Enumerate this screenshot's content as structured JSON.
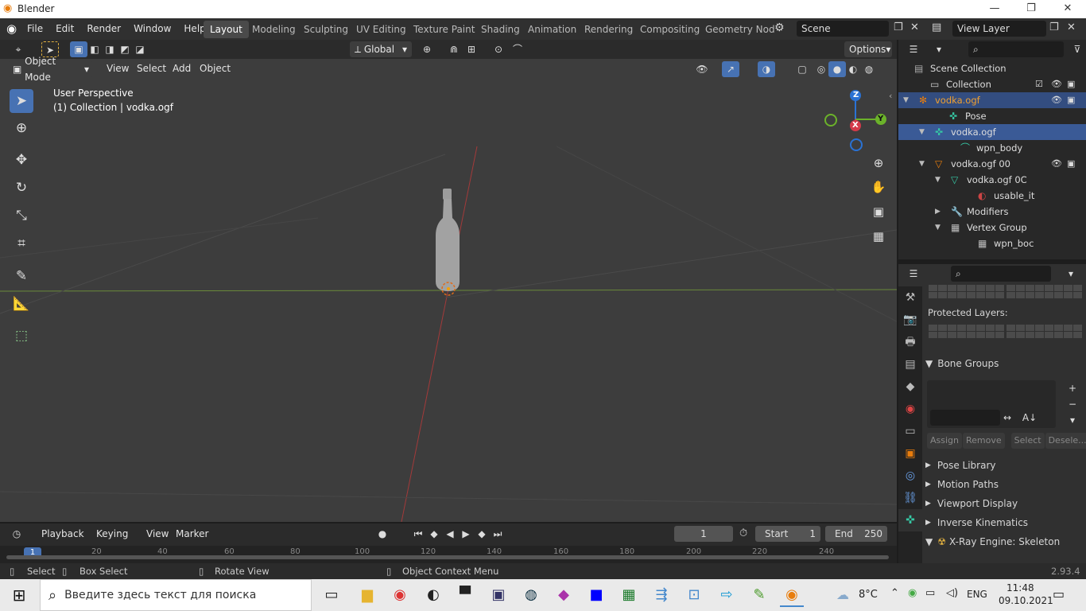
{
  "window": {
    "title": "Blender",
    "minimize": "—",
    "maximize": "❐",
    "close": "✕"
  },
  "menu": [
    "File",
    "Edit",
    "Render",
    "Window",
    "Help"
  ],
  "workspaces": [
    "Layout",
    "Modeling",
    "Sculpting",
    "UV Editing",
    "Texture Paint",
    "Shading",
    "Animation",
    "Rendering",
    "Compositing",
    "Geometry Nod"
  ],
  "scene": "Scene",
  "view_layer": "View Layer",
  "header": {
    "orientation": "Global",
    "options": "Options",
    "mode": "Object Mode",
    "menus": [
      "View",
      "Select",
      "Add",
      "Object"
    ]
  },
  "viewport": {
    "title": "User Perspective",
    "subtitle": "(1) Collection | vodka.ogf",
    "axis_x": "X",
    "axis_y": "Y",
    "axis_z": "Z"
  },
  "outliner": {
    "rows": [
      {
        "label": "Scene Collection",
        "icon": "scene-collection-icon",
        "glyph": "▤"
      },
      {
        "label": "Collection",
        "icon": "collection-icon",
        "glyph": "▭"
      },
      {
        "label": "vodka.ogf",
        "icon": "armature-icon",
        "glyph": "✻",
        "expand": "▼"
      },
      {
        "label": "Pose",
        "icon": "pose-icon",
        "glyph": "✜"
      },
      {
        "label": "vodka.ogf",
        "icon": "armature-data-icon",
        "glyph": "✜",
        "expand": "▼"
      },
      {
        "label": "wpn_body",
        "icon": "bone-icon",
        "glyph": "⌒"
      },
      {
        "label": "vodka.ogf 00",
        "icon": "mesh-object-icon",
        "glyph": "▽",
        "expand": "▼"
      },
      {
        "label": "vodka.ogf 0C",
        "icon": "mesh-data-icon",
        "glyph": "▽",
        "expand": "▼"
      },
      {
        "label": "usable_it",
        "icon": "material-icon",
        "glyph": "◐"
      },
      {
        "label": "Modifiers",
        "icon": "wrench-icon",
        "glyph": "🔧",
        "expand": "▶"
      },
      {
        "label": "Vertex Group",
        "icon": "vertex-group-icon",
        "glyph": "▦",
        "expand": "▼"
      },
      {
        "label": "wpn_boc",
        "icon": "vertex-group-item-icon",
        "glyph": "▦"
      }
    ]
  },
  "properties": {
    "protected_layers": "Protected Layers:",
    "bone_groups": "Bone Groups",
    "assign": "Assign",
    "remove": "Remove",
    "select": "Select",
    "deselect": "Desele...",
    "panels": [
      "Pose Library",
      "Motion Paths",
      "Viewport Display",
      "Inverse Kinematics",
      "X-Ray Engine: Skeleton"
    ]
  },
  "timeline": {
    "menus": [
      "Playback",
      "Keying",
      "View",
      "Marker"
    ],
    "current_frame": "1",
    "start_label": "Start",
    "start": "1",
    "end_label": "End",
    "end": "250",
    "ticks": [
      "1",
      "20",
      "40",
      "60",
      "80",
      "100",
      "120",
      "140",
      "160",
      "180",
      "200",
      "220",
      "240"
    ]
  },
  "status": {
    "select": "Select",
    "box_select": "Box Select",
    "rotate": "Rotate View",
    "context": "Object Context Menu",
    "version": "2.93.4"
  },
  "taskbar": {
    "search_placeholder": "Введите здесь текст для поиска",
    "temperature": "8°C",
    "lang": "ENG",
    "time": "11:48",
    "date": "09.10.2021"
  }
}
